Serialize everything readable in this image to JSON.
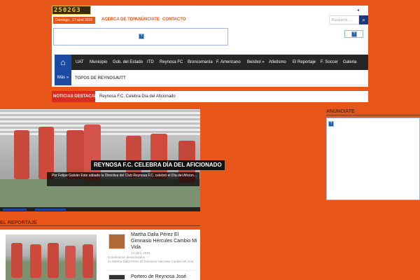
{
  "logo": {
    "text": "2502G3"
  },
  "header": {
    "date": "Domingo , 17 abril 2016",
    "top_links": [
      "ACERCA DE TDR",
      "ANÚNCIATE",
      "CONTACTO"
    ],
    "search_placeholder": "Búsqueda ..."
  },
  "nav": {
    "items": [
      "UAT",
      "Municipio",
      "Gob. del Estado",
      "ITD",
      "Reynosa FC",
      "Broncomanía",
      "F. Americano",
      "Beisbol »",
      "Atletismo",
      "El Reportaje",
      "F. Soccer",
      "Galeria"
    ],
    "more_label": "Más »",
    "sub_items": [
      "TOPOS DE REYNOSA",
      "UTT"
    ]
  },
  "ticker": {
    "label": "NOTICIAS DESTACADAS",
    "text": "Reynosa F.C. Celebra Día del Aficionado"
  },
  "slider": {
    "title": "REYNOSA F.C. CELEBRA DÍA DEL AFICIONADO",
    "excerpt": "Por Felipe Galván Este sábado la Directiva del Club Reynosa F.C. celebró el Día del Aficion..."
  },
  "sidebar": {
    "title": "ANÚNCIATE"
  },
  "reportaje": {
    "title": "EL REPORTAJE",
    "articles": [
      {
        "title": "Martha Dalia Pérez El Gimnasio Hércules Cambio Mi Vida",
        "date": "14 abril, 2016",
        "comments": "Comentarios desactivados",
        "comments_on": "en Martha Dalia Pérez El Gimnasio Hércules Cambio Mi Vida"
      },
      {
        "title": "Portero de Reynosa José"
      }
    ]
  },
  "colors": {
    "page_bg": "#e8561a",
    "nav_bg": "#262626",
    "accent_blue": "#1c4aa3",
    "ticker_red": "#d92b1f"
  }
}
